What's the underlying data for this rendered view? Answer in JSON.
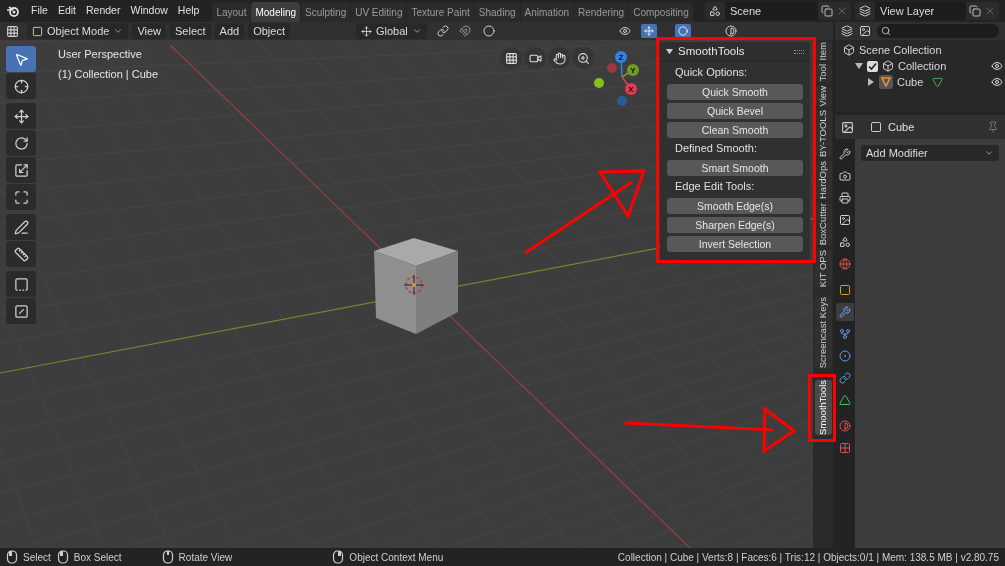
{
  "menu": [
    "File",
    "Edit",
    "Render",
    "Window",
    "Help"
  ],
  "workspaces": [
    {
      "label": "Layout",
      "selected": false
    },
    {
      "label": "Modeling",
      "selected": true
    },
    {
      "label": "Sculpting",
      "selected": false
    },
    {
      "label": "UV Editing",
      "selected": false
    },
    {
      "label": "Texture Paint",
      "selected": false
    },
    {
      "label": "Shading",
      "selected": false
    },
    {
      "label": "Animation",
      "selected": false
    },
    {
      "label": "Rendering",
      "selected": false
    },
    {
      "label": "Compositing",
      "selected": false
    }
  ],
  "scene": "Scene",
  "view_layer": "View Layer",
  "viewport_header": {
    "mode": "Object Mode",
    "menus": [
      "View",
      "Select",
      "Add",
      "Object"
    ],
    "orientation": "Global"
  },
  "tools": [
    {
      "kind": "select-box",
      "selected": true
    },
    {
      "kind": "cursor",
      "selected": false
    },
    {
      "kind": "move",
      "selected": false
    },
    {
      "kind": "rotate",
      "selected": false
    },
    {
      "kind": "scale",
      "selected": false
    },
    {
      "kind": "transform",
      "selected": false
    },
    {
      "kind": "annotate",
      "selected": false
    },
    {
      "kind": "measure",
      "selected": false
    },
    {
      "kind": "corner",
      "selected": false
    },
    {
      "kind": "shear",
      "selected": false
    }
  ],
  "viewport_info": [
    "User Perspective",
    "(1) Collection | Cube"
  ],
  "axes": [
    {
      "label": "Z",
      "color": "#2f83e6"
    },
    {
      "label": "Y",
      "color": "#6f9c1e"
    },
    {
      "label": "X",
      "color": "#e63b52"
    }
  ],
  "sidebar_panel": {
    "title": "SmoothTools",
    "expanded": true,
    "sections": [
      {
        "heading": "Quick Options:",
        "buttons": [
          "Quick Smooth",
          "Quick Bevel",
          "Clean Smooth"
        ]
      },
      {
        "heading": "Defined Smooth:",
        "buttons": [
          "Smart Smooth"
        ]
      },
      {
        "heading": "Edge Edit Tools:",
        "buttons": [
          "Smooth Edge(s)",
          "Sharpen Edge(s)",
          "Invert Selection"
        ]
      }
    ]
  },
  "sidebar_tabs": [
    {
      "label": "Item",
      "selected": false
    },
    {
      "label": "Tool",
      "selected": false
    },
    {
      "label": "View",
      "selected": false
    },
    {
      "label": "BY-TOOLS",
      "selected": false
    },
    {
      "label": "HardOps",
      "selected": false
    },
    {
      "label": "BoxCutter",
      "selected": false
    },
    {
      "label": "KIT OPS",
      "selected": false
    },
    {
      "label": "Screencast Keys",
      "selected": false
    },
    {
      "label": "SmoothTools",
      "selected": true
    }
  ],
  "outliner": [
    {
      "label": "Scene Collection",
      "kind": "scene",
      "children": [
        {
          "label": "Collection",
          "kind": "collection",
          "checked": true,
          "expanded": true,
          "children": [
            {
              "label": "Cube",
              "kind": "mesh",
              "expanded": false
            }
          ]
        }
      ]
    }
  ],
  "properties": {
    "object": "Cube",
    "add_modifier": "Add Modifier",
    "tabs": [
      {
        "kind": "tool",
        "selected": false
      },
      {
        "kind": "render",
        "selected": false
      },
      {
        "kind": "output",
        "selected": false
      },
      {
        "kind": "view-layer",
        "selected": false
      },
      {
        "kind": "scene",
        "selected": false
      },
      {
        "kind": "world",
        "selected": false
      },
      {
        "kind": "object",
        "selected": false
      },
      {
        "kind": "modifier",
        "selected": true
      },
      {
        "kind": "particles",
        "selected": false
      },
      {
        "kind": "physics",
        "selected": false
      },
      {
        "kind": "constraints",
        "selected": false
      },
      {
        "kind": "data",
        "selected": false
      },
      {
        "kind": "material",
        "selected": false
      },
      {
        "kind": "texture",
        "selected": false
      }
    ]
  },
  "status_bar": {
    "hints": [
      {
        "kind": "left-mouse",
        "label": "Select"
      },
      {
        "kind": "drag-mouse",
        "label": "Box Select"
      },
      {
        "kind": "middle-mouse",
        "label": "Rotate View"
      },
      {
        "kind": "right-mouse",
        "label": "Object Context Menu"
      }
    ],
    "stats": "Collection | Cube | Verts:8 | Faces:6 | Tris:12 | Objects:0/1 | Mem: 138.5 MB | v2.80.75"
  }
}
